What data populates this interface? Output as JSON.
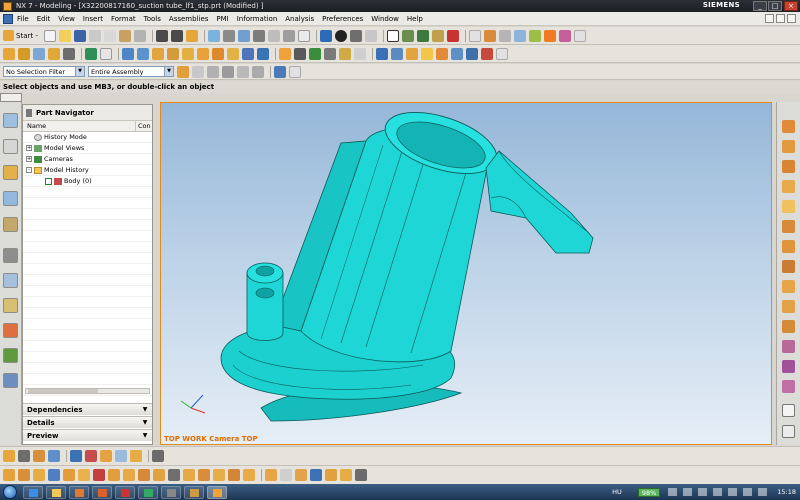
{
  "window": {
    "title": "NX 7 - Modeling - [X32200817160_suction tube_lf1_stp.prt (Modified) ]",
    "brand": "SIEMENS",
    "minimize": "_",
    "maximize": "□",
    "close": "×"
  },
  "menubar": {
    "items": [
      "File",
      "Edit",
      "View",
      "Insert",
      "Format",
      "Tools",
      "Assemblies",
      "PMI",
      "Information",
      "Analysis",
      "Preferences",
      "Window",
      "Help"
    ]
  },
  "toolbar_main": {
    "start_label": "Start -"
  },
  "selection_bar": {
    "filter_value": "No Selection Filter",
    "scope_value": "Entire Assembly"
  },
  "status": {
    "message": "Select objects and use MB3, or double-click an object"
  },
  "navigator": {
    "title": "Part Navigator",
    "columns": [
      "Name",
      "Con"
    ],
    "rows": [
      {
        "label": "History Mode",
        "expander": ""
      },
      {
        "label": "Model Views",
        "expander": "+"
      },
      {
        "label": "Cameras",
        "expander": "+"
      },
      {
        "label": "Model History",
        "expander": "-"
      },
      {
        "label": "Body (0)",
        "expander": ""
      }
    ],
    "panels": [
      "Dependencies",
      "Details",
      "Preview"
    ]
  },
  "graphics": {
    "view_caption": "TOP WORK Camera TOP",
    "model_color": "#19d3d3",
    "background_top": "#95b7d8",
    "background_bottom": "#e6eef6"
  },
  "taskbar": {
    "language": "HU",
    "battery": "98%",
    "clock": "15:18"
  },
  "colors": {
    "title_bar": "#1c1f24",
    "menu_bar": "#eceae5",
    "taskbar": "#1d3553",
    "selection_border": "#e38a19"
  }
}
